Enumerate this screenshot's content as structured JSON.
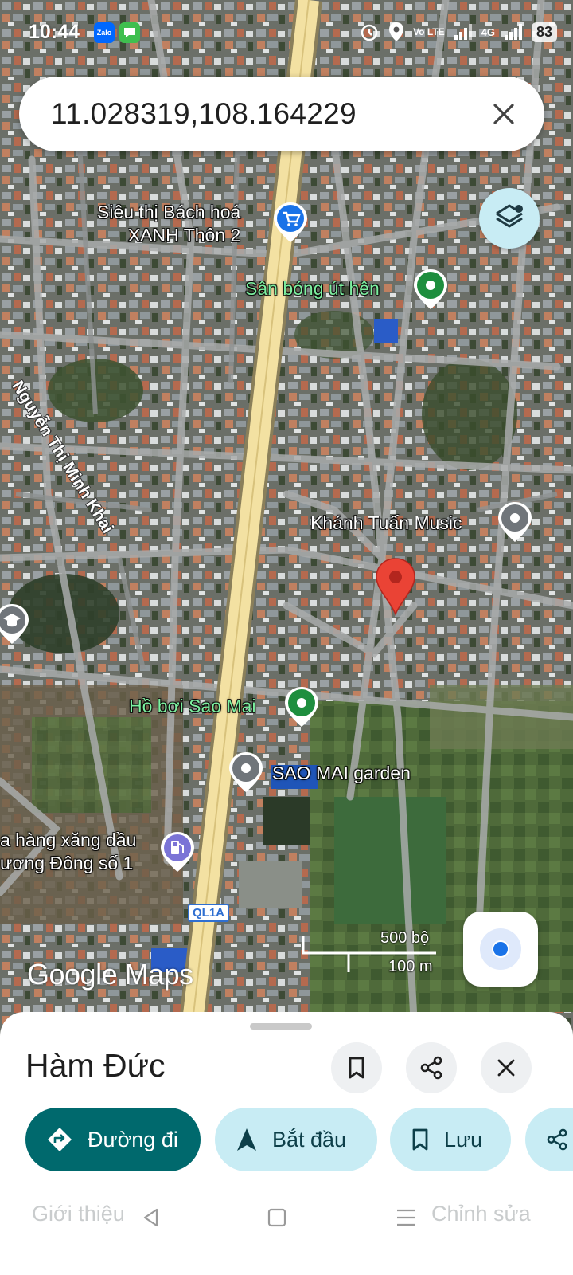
{
  "status_bar": {
    "time": "10:44",
    "apps": [
      {
        "icon": "zalo-icon",
        "label": "Zalo",
        "color": "#0068ff"
      },
      {
        "icon": "messages-icon",
        "label": "",
        "color": "#3fbf4f"
      }
    ],
    "lte_label": "Vo LTE",
    "signal_label": "4G",
    "battery": "83"
  },
  "search": {
    "query": "11.028319,108.164229"
  },
  "map": {
    "places": [
      {
        "label_line1": "Siêu thị Bách hoá",
        "label_line2": "XANH Thôn 2",
        "icon": "shopping-cart-icon",
        "color": "#1a73e8"
      },
      {
        "label": "Sân bóng út hên",
        "icon": "park-pin-icon",
        "color": "#1e8e3e"
      },
      {
        "label": "Khánh Tuấn Music",
        "icon": "generic-pin-icon",
        "color": "#70757a"
      },
      {
        "label": "Hồ bơi Sao Mai",
        "icon": "park-pin-icon",
        "color": "#1e8e3e"
      },
      {
        "label": "SAO MAI garden",
        "icon": "generic-pin-icon",
        "color": "#70757a"
      },
      {
        "label_line1": "a hàng xăng dầu",
        "label_line2": "ương Đông số 1",
        "icon": "gas-station-icon",
        "color": "#7b74d6"
      },
      {
        "label": "",
        "icon": "school-icon",
        "color": "#70757a"
      }
    ],
    "street": "Nguyễn Thị Minh Khai",
    "route_shield": "QL1A",
    "scale": {
      "top": "500 bộ",
      "bottom": "100 m"
    },
    "attribution": "Google Maps",
    "marker_color": "#ea4335"
  },
  "sheet": {
    "title": "Hàm Đức",
    "actions": [
      {
        "label": "Đường đi",
        "icon": "directions-icon"
      },
      {
        "label": "Bắt đầu",
        "icon": "navigation-arrow-icon"
      },
      {
        "label": "Lưu",
        "icon": "bookmark-icon"
      }
    ],
    "tab_left": "Giới thiệu",
    "tab_right": "Chỉnh sửa"
  },
  "colors": {
    "primary_teal": "#00696d",
    "chip_light": "#c8ecf4",
    "location_blue": "#1a73e8"
  }
}
